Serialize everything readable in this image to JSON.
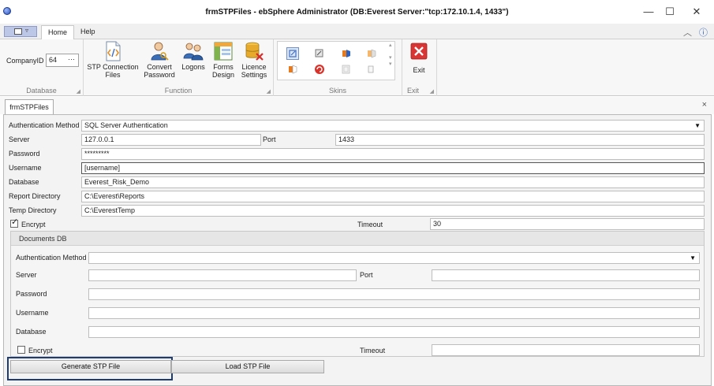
{
  "window": {
    "title": "frmSTPFiles - ebSphere Administrator (DB:Everest Server:\"tcp:172.10.1.4, 1433\")",
    "minimize": "—",
    "maximize": "☐",
    "close": "✕"
  },
  "ribbon_tabs": [
    {
      "label": "Home",
      "active": true
    },
    {
      "label": "Help",
      "active": false
    }
  ],
  "ribbon": {
    "company_label": "CompanyID",
    "company_value": "64",
    "company_dots": "···",
    "groups": {
      "database": "Database",
      "function": "Function",
      "skins": "Skins",
      "exit": "Exit"
    },
    "buttons": {
      "stp_line1": "STP Connection",
      "stp_line2": "Files",
      "convert_line1": "Convert",
      "convert_line2": "Password",
      "logons": "Logons",
      "forms_line1": "Forms",
      "forms_line2": "Design",
      "licence_line1": "Licence",
      "licence_line2": "Settings",
      "exit": "Exit"
    }
  },
  "document_tab": {
    "label": "frmSTPFiles",
    "close": "×"
  },
  "form": {
    "auth_label": "Authentication Method",
    "auth_value": "SQL Server Authentication",
    "server_label": "Server",
    "server_value": "127.0.0.1",
    "port_label": "Port",
    "port_value": "1433",
    "password_label": "Password",
    "password_value": "*********",
    "username_label": "Username",
    "username_value": "[username]",
    "database_label": "Database",
    "database_value": "Everest_Risk_Demo",
    "report_label": "Report Directory",
    "report_value": "C:\\Everest\\Reports",
    "temp_label": "Temp Directory",
    "temp_value": "C:\\EverestTemp",
    "encrypt_label": "Encrypt",
    "encrypt_checked": true,
    "timeout_label": "Timeout",
    "timeout_value": "30"
  },
  "documents_db": {
    "title": "Documents DB",
    "auth_label": "Authentication Method",
    "auth_value": "",
    "server_label": "Server",
    "server_value": "",
    "port_label": "Port",
    "port_value": "",
    "password_label": "Password",
    "password_value": "",
    "username_label": "Username",
    "username_value": "",
    "database_label": "Database",
    "database_value": "",
    "encrypt_label": "Encrypt",
    "encrypt_checked": false,
    "timeout_label": "Timeout",
    "timeout_value": ""
  },
  "actions": {
    "generate": "Generate STP File",
    "load": "Load STP File"
  },
  "colors": {
    "accent": "#1f3b73",
    "file_tab": "#bcc6e6"
  }
}
